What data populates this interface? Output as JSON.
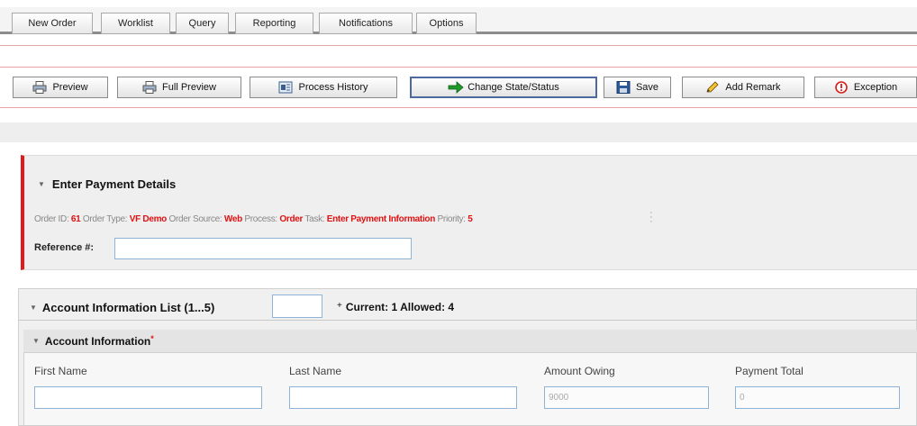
{
  "nav": {
    "tabs": [
      "New Order",
      "Worklist",
      "Query",
      "Reporting",
      "Notifications",
      "Options"
    ]
  },
  "toolbar": {
    "preview": {
      "label": "Preview",
      "icon": "printer-icon"
    },
    "full_preview": {
      "label": "Full Preview",
      "icon": "printer-icon"
    },
    "process_history": {
      "label": "Process History",
      "icon": "history-icon"
    },
    "change_state": {
      "label": "Change State/Status",
      "icon": "green-arrow-icon"
    },
    "save": {
      "label": "Save",
      "icon": "floppy-disk-icon"
    },
    "add_remark": {
      "label": "Add Remark",
      "icon": "pencil-icon"
    },
    "exception": {
      "label": "Exception",
      "icon": "exclamation-icon"
    }
  },
  "task": {
    "title": "Enter Payment Details",
    "order_id_label": "Order ID:",
    "order_id": "61",
    "order_type_label": "Order Type:",
    "order_type": "VF Demo",
    "order_source_label": "Order Source:",
    "order_source": "Web",
    "process_label": "Process:",
    "process": "Order",
    "task_label": "Task:",
    "task": "Enter Payment Information",
    "priority_label": "Priority:",
    "priority": "5",
    "reference_label": "Reference #:",
    "reference_value": ""
  },
  "list": {
    "title": "Account Information List (1...5)",
    "stepper_value": "",
    "current_allowed": "Current: 1 Allowed: 4"
  },
  "account": {
    "title": "Account Information",
    "required_mark": "*",
    "first_name_label": "First Name",
    "last_name_label": "Last Name",
    "amount_owing_label": "Amount Owing",
    "payment_total_label": "Payment Total",
    "first_name_value": "",
    "last_name_value": "",
    "amount_owing_value": "9000",
    "payment_total_value": "0"
  },
  "colors": {
    "accent_red": "#e01212",
    "input_border": "#8eb3d4",
    "primary_button_border": "#4d6a9e"
  }
}
